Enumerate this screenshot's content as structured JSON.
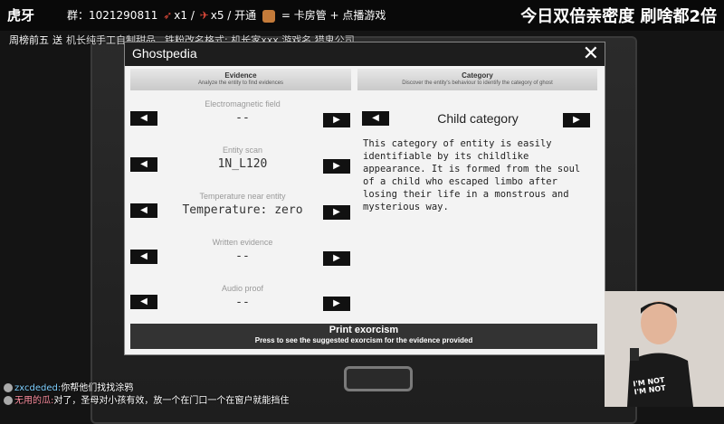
{
  "stream": {
    "logo": "虎牙",
    "fan_group": "群：1021290811",
    "gift_count_1": "x1",
    "gift_count_2": "x5",
    "promo": "开通",
    "promo_2": "= 卡房管 + 点播游戏",
    "banner_right": "今日双倍亲密度 刷啥都2倍",
    "sub_sender": "周榜前五",
    "sub_gift": "送",
    "sub_product": "机长纯手工自制甜品",
    "sub_rule": "铁粉改名格式: 机长家xxx 游戏名 猎鬼公司"
  },
  "window": {
    "title": "Ghostpedia",
    "close": "✕"
  },
  "evidence": {
    "header": "Evidence",
    "subheader": "Analyze the entity to find evidences",
    "items": [
      {
        "label": "Electromagnetic field",
        "value": "--"
      },
      {
        "label": "Entity scan",
        "value": "1N_L120"
      },
      {
        "label": "Temperature near entity",
        "value": "Temperature: zero"
      },
      {
        "label": "Written evidence",
        "value": "--"
      },
      {
        "label": "Audio proof",
        "value": "--"
      }
    ]
  },
  "category": {
    "header": "Category",
    "subheader": "Discover the entity's behaviour to identify the category of ghost",
    "value": "Child category",
    "description": "This category of entity is easily identifiable by its childlike appearance. It is formed from the soul of a child who escaped limbo after losing their life in a monstrous and mysterious way."
  },
  "print": {
    "label": "Print exorcism",
    "sublabel": "Press to see the suggested exorcism for the evidence provided"
  },
  "arrows": {
    "left": "◀",
    "right": "▶"
  },
  "webcam": {
    "shirt": "I'M NOT\nI'M NOT"
  },
  "chat": [
    {
      "user": "zxcdeded:",
      "message": "你帮他们找找涂鸦"
    },
    {
      "user": "无用的瓜:",
      "message": "对了，圣母对小孩有效，放一个在门口一个在窗户就能挡住"
    }
  ],
  "colors": {
    "window_bg": "#f3f3f3",
    "titlebar": "#1d1d1d",
    "button": "#111111",
    "print_button": "#333333"
  }
}
